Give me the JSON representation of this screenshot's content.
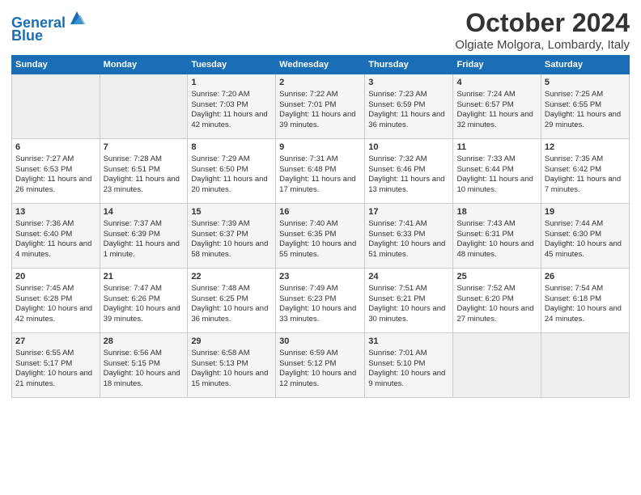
{
  "header": {
    "logo_line1": "General",
    "logo_line2": "Blue",
    "title": "October 2024",
    "subtitle": "Olgiate Molgora, Lombardy, Italy"
  },
  "weekdays": [
    "Sunday",
    "Monday",
    "Tuesday",
    "Wednesday",
    "Thursday",
    "Friday",
    "Saturday"
  ],
  "weeks": [
    [
      {
        "day": "",
        "info": ""
      },
      {
        "day": "",
        "info": ""
      },
      {
        "day": "1",
        "info": "Sunrise: 7:20 AM\nSunset: 7:03 PM\nDaylight: 11 hours and 42 minutes."
      },
      {
        "day": "2",
        "info": "Sunrise: 7:22 AM\nSunset: 7:01 PM\nDaylight: 11 hours and 39 minutes."
      },
      {
        "day": "3",
        "info": "Sunrise: 7:23 AM\nSunset: 6:59 PM\nDaylight: 11 hours and 36 minutes."
      },
      {
        "day": "4",
        "info": "Sunrise: 7:24 AM\nSunset: 6:57 PM\nDaylight: 11 hours and 32 minutes."
      },
      {
        "day": "5",
        "info": "Sunrise: 7:25 AM\nSunset: 6:55 PM\nDaylight: 11 hours and 29 minutes."
      }
    ],
    [
      {
        "day": "6",
        "info": "Sunrise: 7:27 AM\nSunset: 6:53 PM\nDaylight: 11 hours and 26 minutes."
      },
      {
        "day": "7",
        "info": "Sunrise: 7:28 AM\nSunset: 6:51 PM\nDaylight: 11 hours and 23 minutes."
      },
      {
        "day": "8",
        "info": "Sunrise: 7:29 AM\nSunset: 6:50 PM\nDaylight: 11 hours and 20 minutes."
      },
      {
        "day": "9",
        "info": "Sunrise: 7:31 AM\nSunset: 6:48 PM\nDaylight: 11 hours and 17 minutes."
      },
      {
        "day": "10",
        "info": "Sunrise: 7:32 AM\nSunset: 6:46 PM\nDaylight: 11 hours and 13 minutes."
      },
      {
        "day": "11",
        "info": "Sunrise: 7:33 AM\nSunset: 6:44 PM\nDaylight: 11 hours and 10 minutes."
      },
      {
        "day": "12",
        "info": "Sunrise: 7:35 AM\nSunset: 6:42 PM\nDaylight: 11 hours and 7 minutes."
      }
    ],
    [
      {
        "day": "13",
        "info": "Sunrise: 7:36 AM\nSunset: 6:40 PM\nDaylight: 11 hours and 4 minutes."
      },
      {
        "day": "14",
        "info": "Sunrise: 7:37 AM\nSunset: 6:39 PM\nDaylight: 11 hours and 1 minute."
      },
      {
        "day": "15",
        "info": "Sunrise: 7:39 AM\nSunset: 6:37 PM\nDaylight: 10 hours and 58 minutes."
      },
      {
        "day": "16",
        "info": "Sunrise: 7:40 AM\nSunset: 6:35 PM\nDaylight: 10 hours and 55 minutes."
      },
      {
        "day": "17",
        "info": "Sunrise: 7:41 AM\nSunset: 6:33 PM\nDaylight: 10 hours and 51 minutes."
      },
      {
        "day": "18",
        "info": "Sunrise: 7:43 AM\nSunset: 6:31 PM\nDaylight: 10 hours and 48 minutes."
      },
      {
        "day": "19",
        "info": "Sunrise: 7:44 AM\nSunset: 6:30 PM\nDaylight: 10 hours and 45 minutes."
      }
    ],
    [
      {
        "day": "20",
        "info": "Sunrise: 7:45 AM\nSunset: 6:28 PM\nDaylight: 10 hours and 42 minutes."
      },
      {
        "day": "21",
        "info": "Sunrise: 7:47 AM\nSunset: 6:26 PM\nDaylight: 10 hours and 39 minutes."
      },
      {
        "day": "22",
        "info": "Sunrise: 7:48 AM\nSunset: 6:25 PM\nDaylight: 10 hours and 36 minutes."
      },
      {
        "day": "23",
        "info": "Sunrise: 7:49 AM\nSunset: 6:23 PM\nDaylight: 10 hours and 33 minutes."
      },
      {
        "day": "24",
        "info": "Sunrise: 7:51 AM\nSunset: 6:21 PM\nDaylight: 10 hours and 30 minutes."
      },
      {
        "day": "25",
        "info": "Sunrise: 7:52 AM\nSunset: 6:20 PM\nDaylight: 10 hours and 27 minutes."
      },
      {
        "day": "26",
        "info": "Sunrise: 7:54 AM\nSunset: 6:18 PM\nDaylight: 10 hours and 24 minutes."
      }
    ],
    [
      {
        "day": "27",
        "info": "Sunrise: 6:55 AM\nSunset: 5:17 PM\nDaylight: 10 hours and 21 minutes."
      },
      {
        "day": "28",
        "info": "Sunrise: 6:56 AM\nSunset: 5:15 PM\nDaylight: 10 hours and 18 minutes."
      },
      {
        "day": "29",
        "info": "Sunrise: 6:58 AM\nSunset: 5:13 PM\nDaylight: 10 hours and 15 minutes."
      },
      {
        "day": "30",
        "info": "Sunrise: 6:59 AM\nSunset: 5:12 PM\nDaylight: 10 hours and 12 minutes."
      },
      {
        "day": "31",
        "info": "Sunrise: 7:01 AM\nSunset: 5:10 PM\nDaylight: 10 hours and 9 minutes."
      },
      {
        "day": "",
        "info": ""
      },
      {
        "day": "",
        "info": ""
      }
    ]
  ]
}
